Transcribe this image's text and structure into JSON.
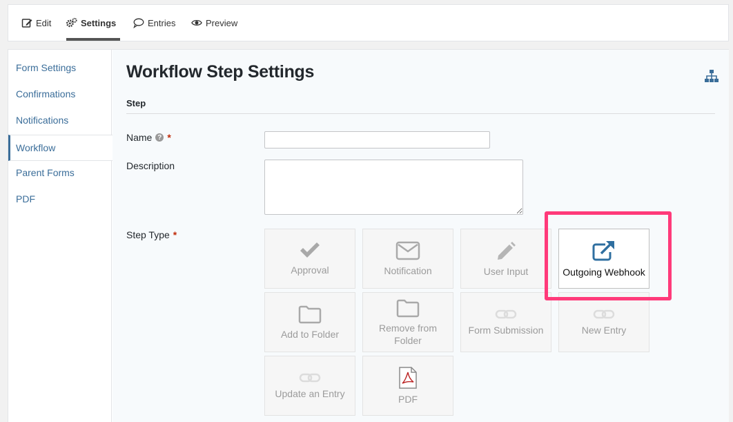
{
  "tabs": [
    {
      "label": "Edit",
      "icon": "edit-icon"
    },
    {
      "label": "Settings",
      "icon": "gears-icon",
      "active": true
    },
    {
      "label": "Entries",
      "icon": "comment-icon"
    },
    {
      "label": "Preview",
      "icon": "eye-icon"
    }
  ],
  "sidebar": {
    "items": [
      {
        "label": "Form Settings"
      },
      {
        "label": "Confirmations"
      },
      {
        "label": "Notifications"
      },
      {
        "label": "Workflow",
        "active": true
      },
      {
        "label": "Parent Forms"
      },
      {
        "label": "PDF"
      }
    ]
  },
  "page": {
    "title": "Workflow Step Settings",
    "section": "Step",
    "name_label": "Name",
    "name_value": "",
    "description_label": "Description",
    "description_value": "",
    "step_type_label": "Step Type",
    "required_mark": "*",
    "help_mark": "?"
  },
  "step_types": [
    {
      "label": "Approval",
      "icon": "check-icon",
      "enabled": false
    },
    {
      "label": "Notification",
      "icon": "envelope-icon",
      "enabled": false
    },
    {
      "label": "User Input",
      "icon": "pencil-icon",
      "enabled": false
    },
    {
      "label": "Outgoing Webhook",
      "icon": "external-link-icon",
      "enabled": true,
      "highlighted": true
    },
    {
      "label": "Add to Folder",
      "icon": "folder-icon",
      "enabled": false
    },
    {
      "label": "Remove from Folder",
      "icon": "folder-icon",
      "enabled": false
    },
    {
      "label": "Form Submission",
      "icon": "link-icon",
      "enabled": false
    },
    {
      "label": "New Entry",
      "icon": "link-icon",
      "enabled": false
    },
    {
      "label": "Update an Entry",
      "icon": "link-icon",
      "enabled": false
    },
    {
      "label": "PDF",
      "icon": "pdf-file-icon",
      "enabled": false
    }
  ],
  "colors": {
    "accent": "#3a6d99",
    "highlight": "#ff3a7a",
    "required": "#c02b0a"
  }
}
